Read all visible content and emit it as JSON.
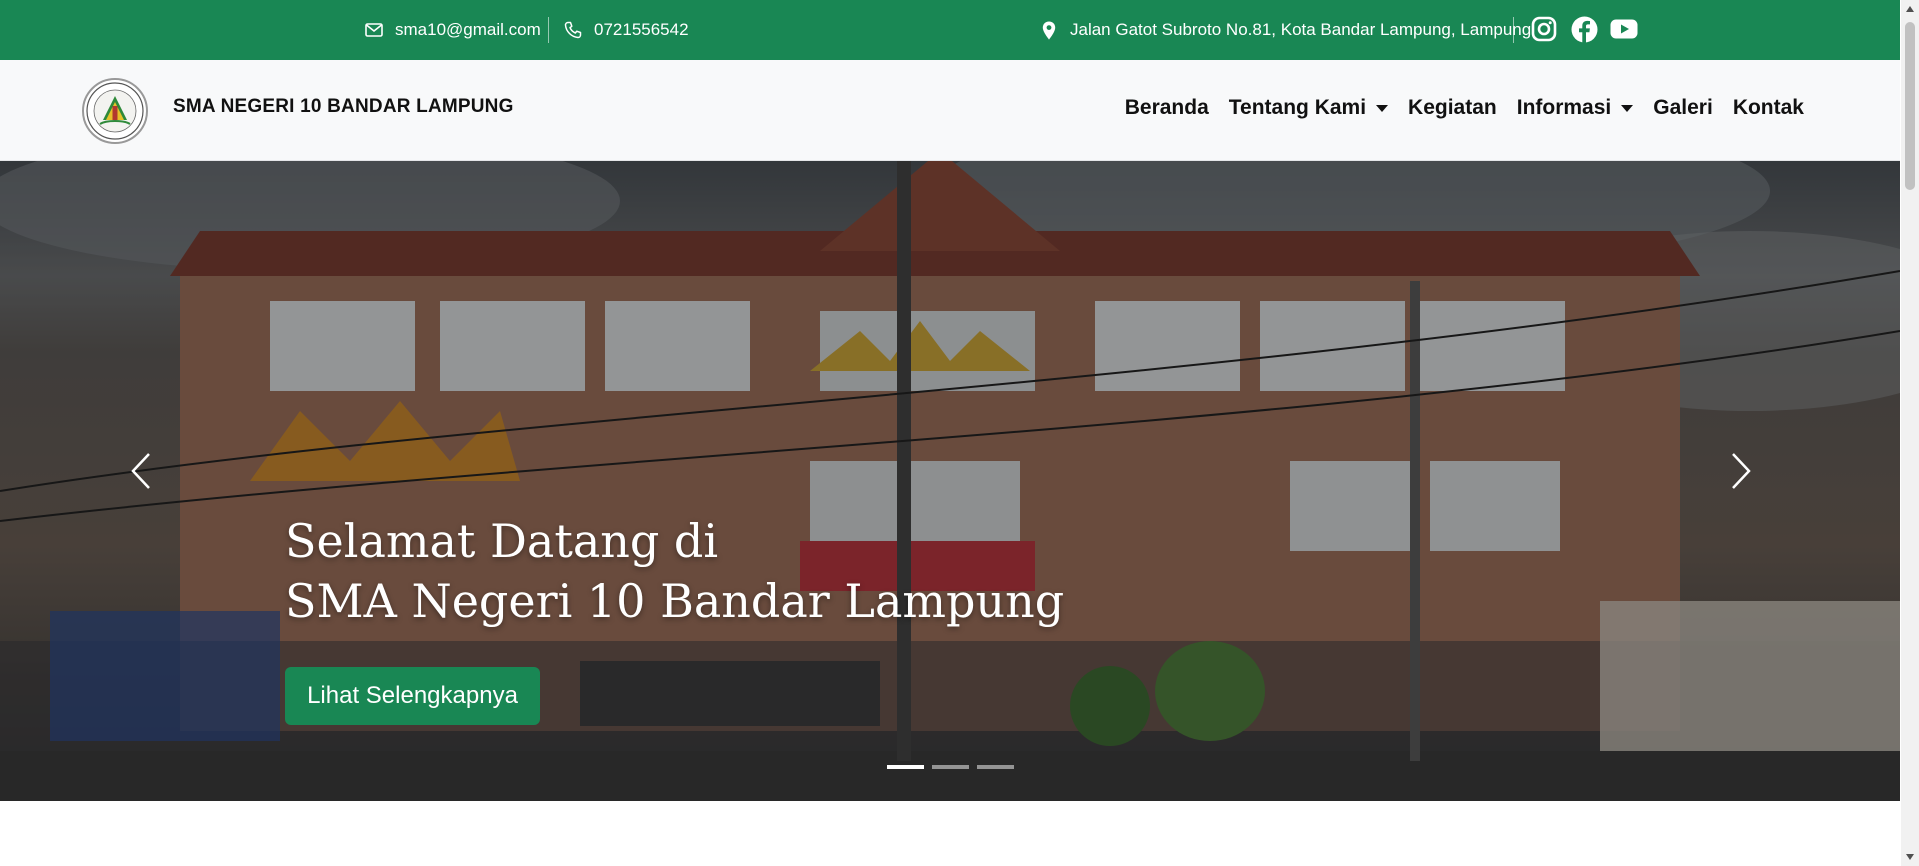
{
  "topbar": {
    "email": "sma10@gmail.com",
    "phone": "0721556542",
    "address": "Jalan Gatot Subroto No.81, Kota Bandar Lampung, Lampung",
    "icons": [
      "mail-icon",
      "phone-icon",
      "location-pin-icon"
    ],
    "social": [
      "instagram-icon",
      "facebook-icon",
      "youtube-icon"
    ],
    "bg_color": "#198754"
  },
  "navbar": {
    "brand": "SMA NEGERI 10 BANDAR LAMPUNG",
    "items": [
      {
        "label": "Beranda"
      },
      {
        "label": "Tentang Kami",
        "dropdown": true
      },
      {
        "label": "Kegiatan"
      },
      {
        "label": "Informasi",
        "dropdown": true
      },
      {
        "label": "Galeri"
      },
      {
        "label": "Kontak"
      }
    ]
  },
  "hero": {
    "title_line1": "Selamat Datang di",
    "title_line2": "SMA Negeri 10 Bandar Lampung",
    "button_label": "Lihat Selengkapnya",
    "slide_count": 3,
    "active_slide": 1
  },
  "colors": {
    "accent": "#198754"
  }
}
